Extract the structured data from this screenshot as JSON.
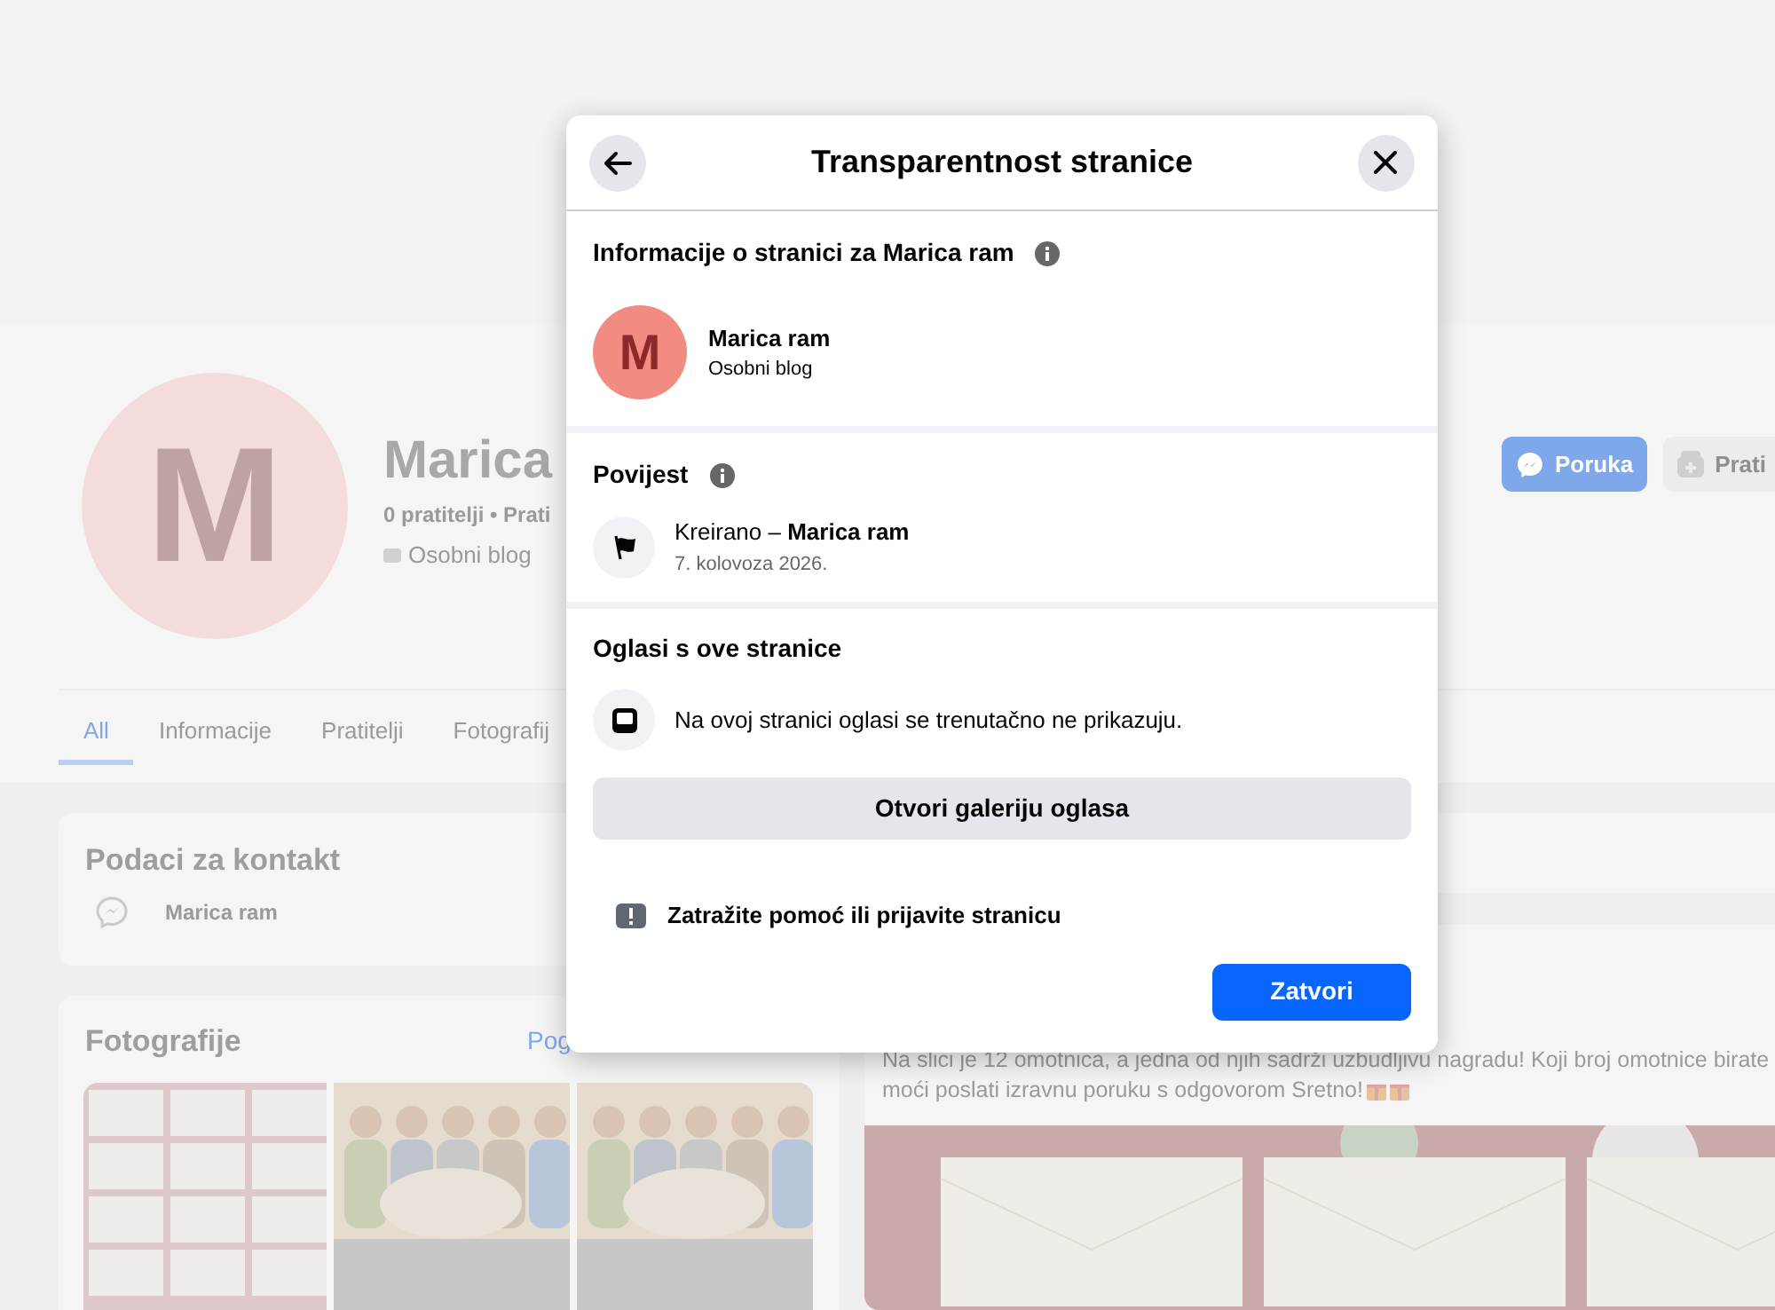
{
  "profile": {
    "avatar_letter": "M",
    "name": "Marica",
    "stats": "0 pratitelji • Prati",
    "category": "Osobni blog",
    "buttons": [
      {
        "label": "Poruka",
        "kind": "primary"
      },
      {
        "label": "Prati",
        "kind": "secondary"
      }
    ]
  },
  "tabs": [
    {
      "label": "All",
      "selected": true
    },
    {
      "label": "Informacije",
      "selected": false
    },
    {
      "label": "Pratitelji",
      "selected": false
    },
    {
      "label": "Fotografij",
      "selected": false
    }
  ],
  "contact_card": {
    "title": "Podaci za kontakt",
    "items": [
      "Marica ram"
    ]
  },
  "photos_card": {
    "title": "Fotografije",
    "link": "Pog"
  },
  "post": {
    "lines": [
      "Na slici je 12 omotnica, a jedna od njih sadrži uzbudljivu nagradu! Koji broj omotnice birate",
      "moći poslati izravnu poruku s odgovorom Sretno!"
    ]
  },
  "dialog": {
    "title": "Transparentnost stranice",
    "page_info": {
      "heading": "Informacije o stranici za Marica ram",
      "avatar_letter": "M",
      "name": "Marica ram",
      "category": "Osobni blog"
    },
    "history": {
      "heading": "Povijest",
      "items": [
        {
          "text": "Kreirano – **Marica ram**",
          "date": "7. kolovoza 2026."
        }
      ]
    },
    "ads": {
      "heading": "Oglasi s ove stranice",
      "message": "Na ovoj stranici oglasi se trenutačno ne prikazuju.",
      "button": "Otvori galeriju oglasa"
    },
    "report_link": "Zatražite pomoć ili prijavite stranicu",
    "close_button": "Zatvori"
  }
}
